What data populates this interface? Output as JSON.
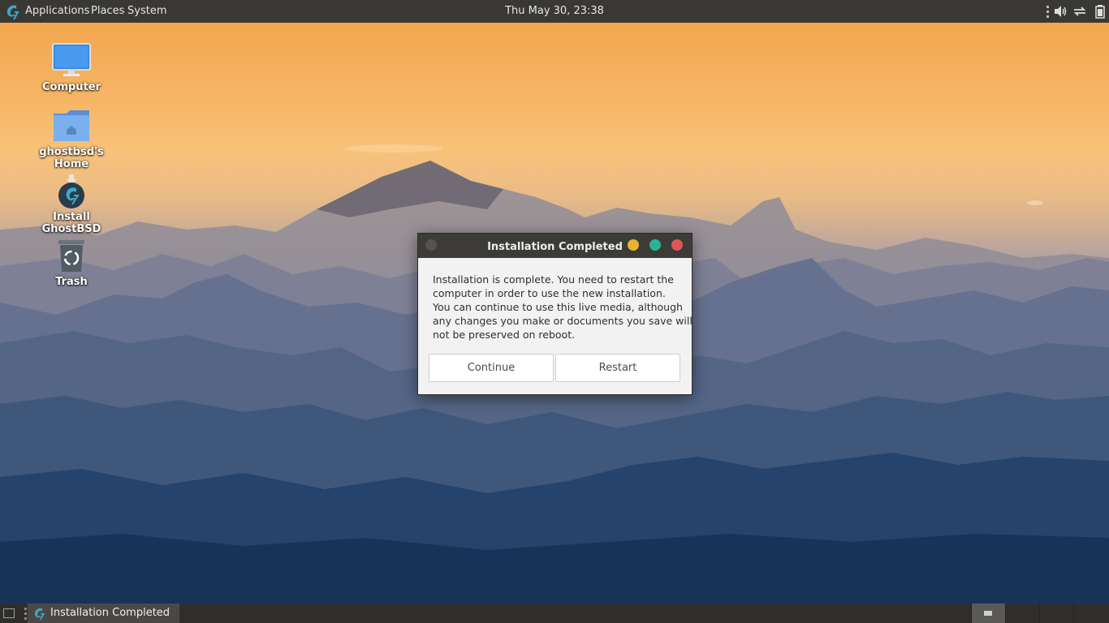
{
  "top_panel": {
    "logo_icon": "ghostbsd-logo-icon",
    "menus": [
      "Applications",
      "Places",
      "System"
    ],
    "clock": "Thu May 30, 23:38",
    "tray_icons": [
      "volume-icon",
      "network-icon",
      "battery-icon"
    ]
  },
  "desktop": {
    "icons": [
      {
        "label": "Computer",
        "icon": "computer-icon"
      },
      {
        "label": "ghostbsd's Home",
        "icon": "home-folder-icon"
      },
      {
        "label": "Install GhostBSD",
        "icon": "install-icon"
      },
      {
        "label": "Trash",
        "icon": "trash-icon"
      }
    ]
  },
  "dialog": {
    "title": "Installation Completed",
    "message_lines": [
      "Installation is complete. You need to restart the",
      "computer in order to use the new installation.",
      "You can continue to use this live media, although",
      "any changes you make or documents you save will",
      "not be preserved on reboot."
    ],
    "buttons": {
      "continue": "Continue",
      "restart": "Restart"
    },
    "window_button_colors": {
      "minimize": "#e8b430",
      "maximize": "#2bb295",
      "close": "#e05555"
    }
  },
  "bottom_panel": {
    "task_label": "Installation Completed",
    "workspace_count": 4,
    "active_workspace": 1
  }
}
